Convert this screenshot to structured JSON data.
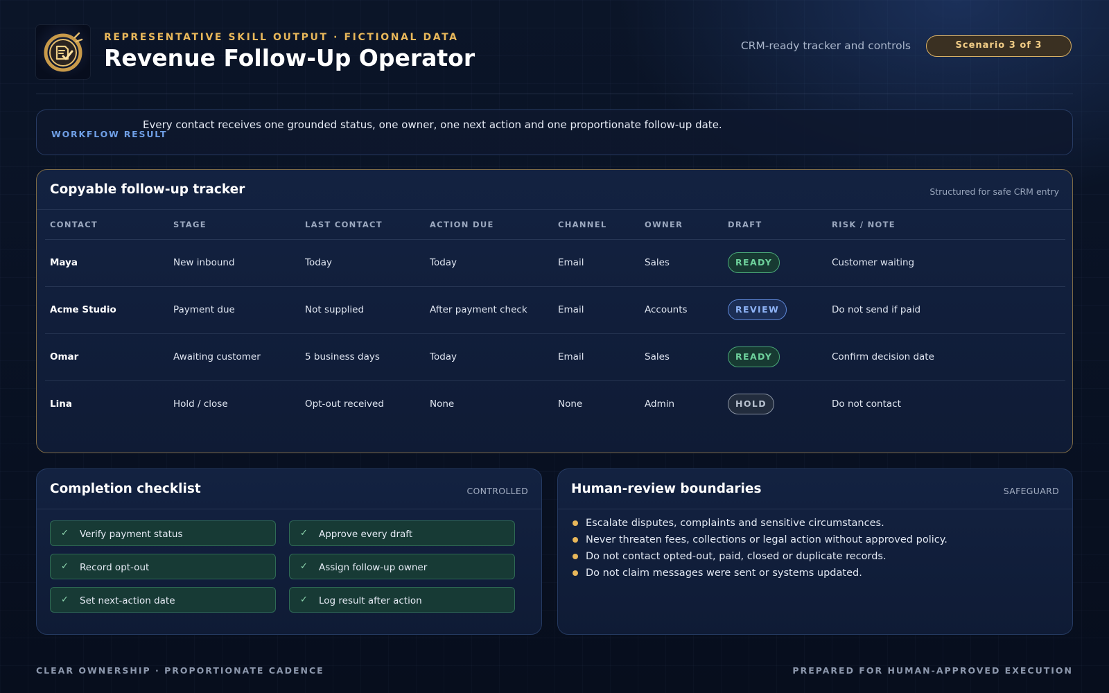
{
  "header": {
    "logo_icon": "checklist-badge-icon",
    "eyebrow": "REPRESENTATIVE SKILL OUTPUT · FICTIONAL DATA",
    "title": "Revenue Follow-Up Operator",
    "tagline": "CRM-ready tracker and controls",
    "scenario_badge": "Scenario 3 of 3"
  },
  "result": {
    "label": "WORKFLOW RESULT",
    "text": "Every contact receives one grounded status, one owner, one next action and one proportionate follow-up date."
  },
  "tracker": {
    "title": "Copyable follow-up tracker",
    "note": "Structured for safe CRM entry",
    "columns": [
      "CONTACT",
      "STAGE",
      "LAST CONTACT",
      "ACTION DUE",
      "CHANNEL",
      "OWNER",
      "DRAFT",
      "RISK / NOTE"
    ],
    "rows": [
      {
        "contact": "Maya",
        "stage": "New inbound",
        "last_contact": "Today",
        "action_due": "Today",
        "channel": "Email",
        "owner": "Sales",
        "draft": "READY",
        "note": "Customer waiting"
      },
      {
        "contact": "Acme Studio",
        "stage": "Payment due",
        "last_contact": "Not supplied",
        "action_due": "After payment check",
        "channel": "Email",
        "owner": "Accounts",
        "draft": "REVIEW",
        "note": "Do not send if paid"
      },
      {
        "contact": "Omar",
        "stage": "Awaiting customer",
        "last_contact": "5 business days",
        "action_due": "Today",
        "channel": "Email",
        "owner": "Sales",
        "draft": "READY",
        "note": "Confirm decision date"
      },
      {
        "contact": "Lina",
        "stage": "Hold / close",
        "last_contact": "Opt-out received",
        "action_due": "None",
        "channel": "None",
        "owner": "Admin",
        "draft": "HOLD",
        "note": "Do not contact"
      }
    ],
    "draft_colors": {
      "READY": "#6ed29c",
      "REVIEW": "#8fb4f7",
      "HOLD": "#b7c0ce"
    }
  },
  "checklist": {
    "title": "Completion checklist",
    "tag": "CONTROLLED",
    "tick_icon": "check-icon",
    "items": [
      "Verify payment status",
      "Approve every draft",
      "Record opt-out",
      "Assign follow-up owner",
      "Set next-action date",
      "Log result after action"
    ]
  },
  "boundaries": {
    "title": "Human-review boundaries",
    "tag": "SAFEGUARD",
    "bullet_icon": "dot-icon",
    "items": [
      "Escalate disputes, complaints and sensitive circumstances.",
      "Never threaten fees, collections or legal action without approved policy.",
      "Do not contact opted-out, paid, closed or duplicate records.",
      "Do not claim messages were sent or systems updated."
    ]
  },
  "footer": {
    "left": "CLEAR OWNERSHIP · PROPORTIONATE CADENCE",
    "right": "PREPARED FOR HUMAN-APPROVED EXECUTION"
  },
  "colors": {
    "accent_gold": "#e8b75a",
    "accent_blue": "#6f9fe6",
    "background": "#091224"
  }
}
